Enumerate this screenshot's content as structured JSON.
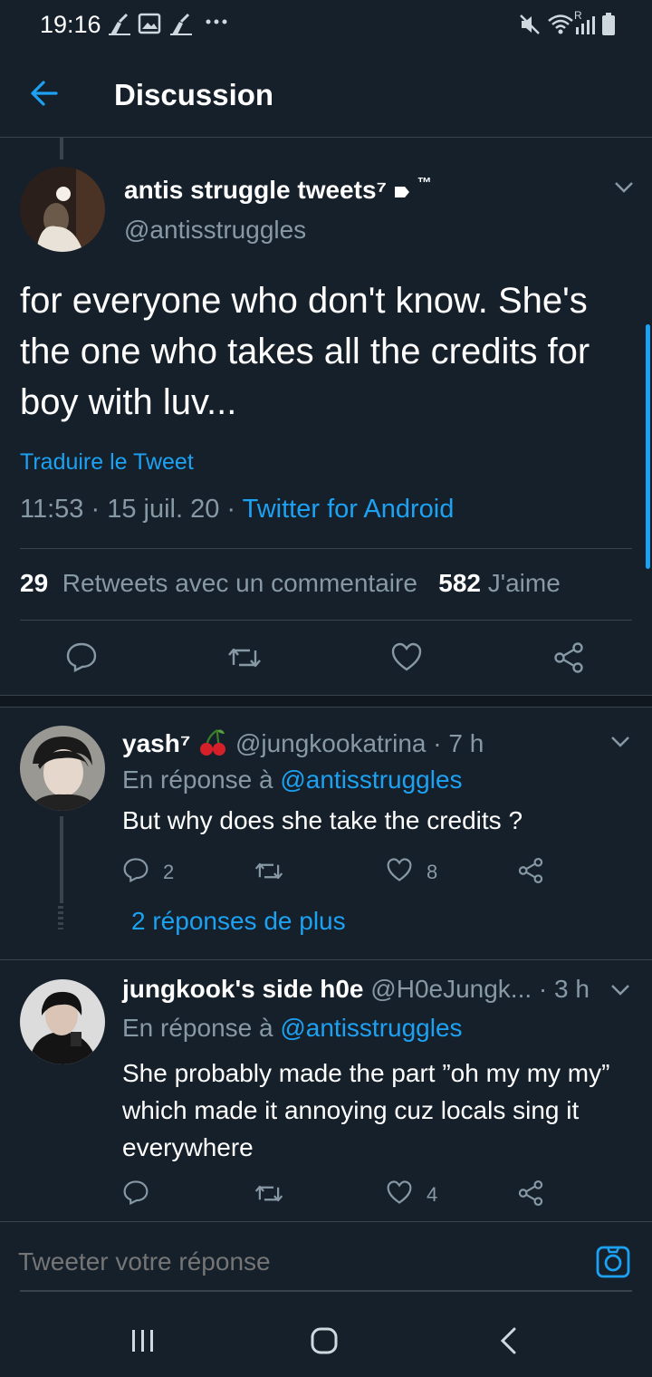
{
  "status_bar": {
    "time": "19:16",
    "left_icons": [
      "broom-icon",
      "image-icon",
      "broom-icon",
      "more-dots-icon"
    ],
    "right_icons": [
      "mute-icon",
      "wifi-icon",
      "signal-icon",
      "battery-icon"
    ],
    "signal_badge": "R"
  },
  "header": {
    "back_icon": "arrow-left-icon",
    "title": "Discussion"
  },
  "main_tweet": {
    "display_name": "antis struggle tweets⁷",
    "name_suffix": "™",
    "handle": "@antisstruggles",
    "text": "for everyone who don't know. She's the one who takes all the credits for boy with luv...",
    "translate": "Traduire le Tweet",
    "time": "11:53",
    "sep1": " · ",
    "date": "15 juil. 20",
    "sep2": " · ",
    "source": "Twitter for Android",
    "retweet_count": "29",
    "retweet_label": "Retweets avec un commentaire",
    "like_count": "582",
    "like_label": "J'aime"
  },
  "replies": [
    {
      "display_name": "yash⁷",
      "emoji": "🍒",
      "handle": "@jungkookatrina",
      "age": " · 7 h",
      "reply_prefix": "En réponse à ",
      "reply_to": "@antisstruggles",
      "text": "But why does she take the credits ?",
      "reply_count": "2",
      "retweet_count": "",
      "like_count": "8",
      "more_replies": "2 réponses de plus"
    },
    {
      "display_name": "jungkook's side h0e",
      "handle": "@H0eJungk...",
      "age": " · 3 h",
      "reply_prefix": "En réponse à ",
      "reply_to": "@antisstruggles",
      "text": "She probably made the part ”oh my my my” which made it annoying cuz locals sing it everywhere",
      "reply_count": "",
      "retweet_count": "",
      "like_count": "4"
    }
  ],
  "compose": {
    "placeholder": "Tweeter votre réponse",
    "camera_icon": "camera-icon"
  },
  "nav": {
    "icons": [
      "recent-apps-icon",
      "home-icon",
      "back-icon"
    ]
  },
  "colors": {
    "background": "#15202b",
    "accent": "#1da1f2",
    "muted": "#8899a6",
    "divider": "#38444d"
  }
}
